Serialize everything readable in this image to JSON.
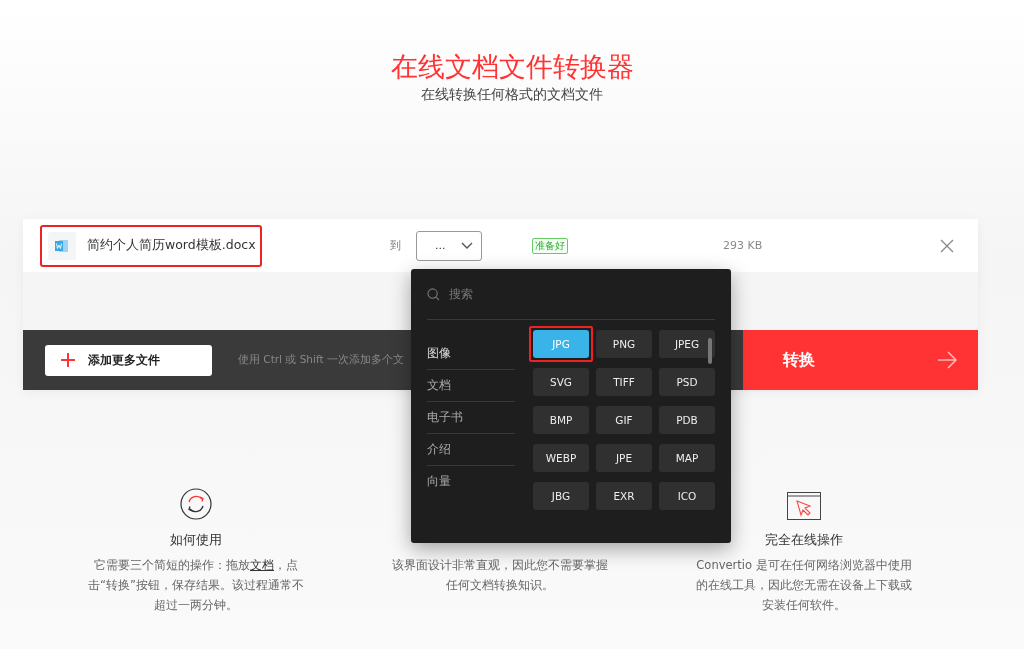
{
  "header": {
    "title": "在线文档文件转换器",
    "subtitle": "在线转换任何格式的文档文件"
  },
  "file": {
    "name": "简约个人简历word模板.docx",
    "highlighted": true,
    "to_label": "到",
    "format_value": "...",
    "status": "准备好",
    "size": "293 KB"
  },
  "actions": {
    "add_button": "添加更多文件",
    "hint": "使用 Ctrl 或 Shift 一次添加多个文",
    "convert_button": "转换"
  },
  "dropdown": {
    "search_placeholder": "搜索",
    "categories": [
      {
        "label": "图像",
        "selected": true
      },
      {
        "label": "文档",
        "selected": false
      },
      {
        "label": "电子书",
        "selected": false
      },
      {
        "label": "介绍",
        "selected": false
      },
      {
        "label": "向量",
        "selected": false
      }
    ],
    "formats": [
      {
        "label": "JPG",
        "selected": true,
        "highlighted": true
      },
      {
        "label": "PNG",
        "selected": false,
        "highlighted": false
      },
      {
        "label": "JPEG",
        "selected": false,
        "highlighted": false
      },
      {
        "label": "SVG",
        "selected": false,
        "highlighted": false
      },
      {
        "label": "TIFF",
        "selected": false,
        "highlighted": false
      },
      {
        "label": "PSD",
        "selected": false,
        "highlighted": false
      },
      {
        "label": "BMP",
        "selected": false,
        "highlighted": false
      },
      {
        "label": "GIF",
        "selected": false,
        "highlighted": false
      },
      {
        "label": "PDB",
        "selected": false,
        "highlighted": false
      },
      {
        "label": "WEBP",
        "selected": false,
        "highlighted": false
      },
      {
        "label": "JPE",
        "selected": false,
        "highlighted": false
      },
      {
        "label": "MAP",
        "selected": false,
        "highlighted": false
      },
      {
        "label": "JBG",
        "selected": false,
        "highlighted": false
      },
      {
        "label": "EXR",
        "selected": false,
        "highlighted": false
      },
      {
        "label": "ICO",
        "selected": false,
        "highlighted": false
      }
    ]
  },
  "features": [
    {
      "title": "如何使用",
      "description": [
        {
          "kind": "text",
          "text": "它需要三个简短的操作：拖放"
        },
        {
          "kind": "link",
          "text": "文档"
        },
        {
          "kind": "text",
          "text": "，点击“转换”按钮，保存结果。该过程通常不超过一两分钟。"
        }
      ]
    },
    {
      "description": [
        {
          "kind": "text",
          "text": "该界面设计非常直观，因此您不需要掌握任何文档转换知识。"
        }
      ]
    },
    {
      "title": "完全在线操作",
      "description": [
        {
          "kind": "text",
          "text": "Convertio 是可在任何网络浏览器中使用的在线工具，因此您无需在设备上下载或安装任何软件。"
        }
      ]
    }
  ]
}
